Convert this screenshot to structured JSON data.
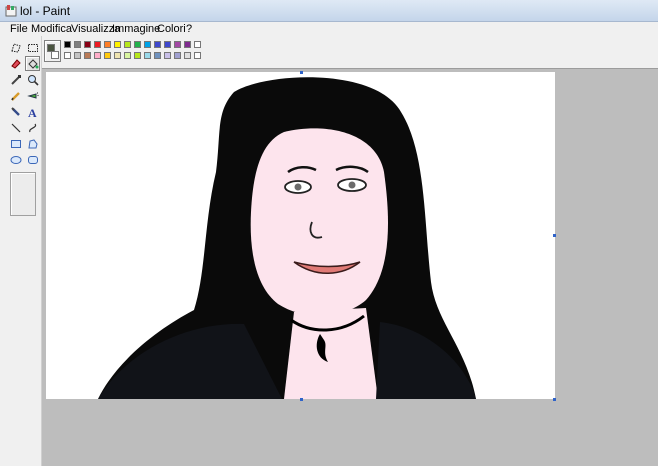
{
  "window": {
    "title": "lol - Paint",
    "icon": "paint-palette-icon"
  },
  "menu": [
    "File",
    "Modifica",
    "Visualizza",
    "Immagine",
    "Colori",
    "?"
  ],
  "tools": [
    "free-select-icon",
    "rect-select-icon",
    "eraser-icon",
    "fill-bucket-icon",
    "eyedropper-icon",
    "magnifier-icon",
    "pencil-icon",
    "airbrush-icon",
    "brush-icon",
    "text-icon",
    "line-icon",
    "curve-icon",
    "rectangle-icon",
    "polygon-icon",
    "ellipse-icon",
    "rounded-rect-icon"
  ],
  "selected_tool": "fill-bucket-icon",
  "colors": {
    "foreground": "#4a5440",
    "background": "#ffffff",
    "row1": [
      "#000000",
      "#7f7f7f",
      "#880015",
      "#ed1c24",
      "#ff7f27",
      "#fff200",
      "#b5e61d",
      "#22b14c",
      "#00a2e8",
      "#3f48cc",
      "#3f48cc",
      "#a349a4",
      "#7f2b8f",
      "#ffffff"
    ],
    "row2": [
      "#ffffff",
      "#c3c3c3",
      "#b97a57",
      "#ffaec9",
      "#ffc90e",
      "#efe4b0",
      "#d9f5a0",
      "#b5e61d",
      "#99d9ea",
      "#7092be",
      "#c8bfe7",
      "#a0a0d0",
      "#e0e0e0",
      "#ffffff"
    ],
    "skin": "#fde4ed",
    "hair": "#0a0a0a",
    "lips": "#e07a76",
    "shirt": "#111318"
  }
}
